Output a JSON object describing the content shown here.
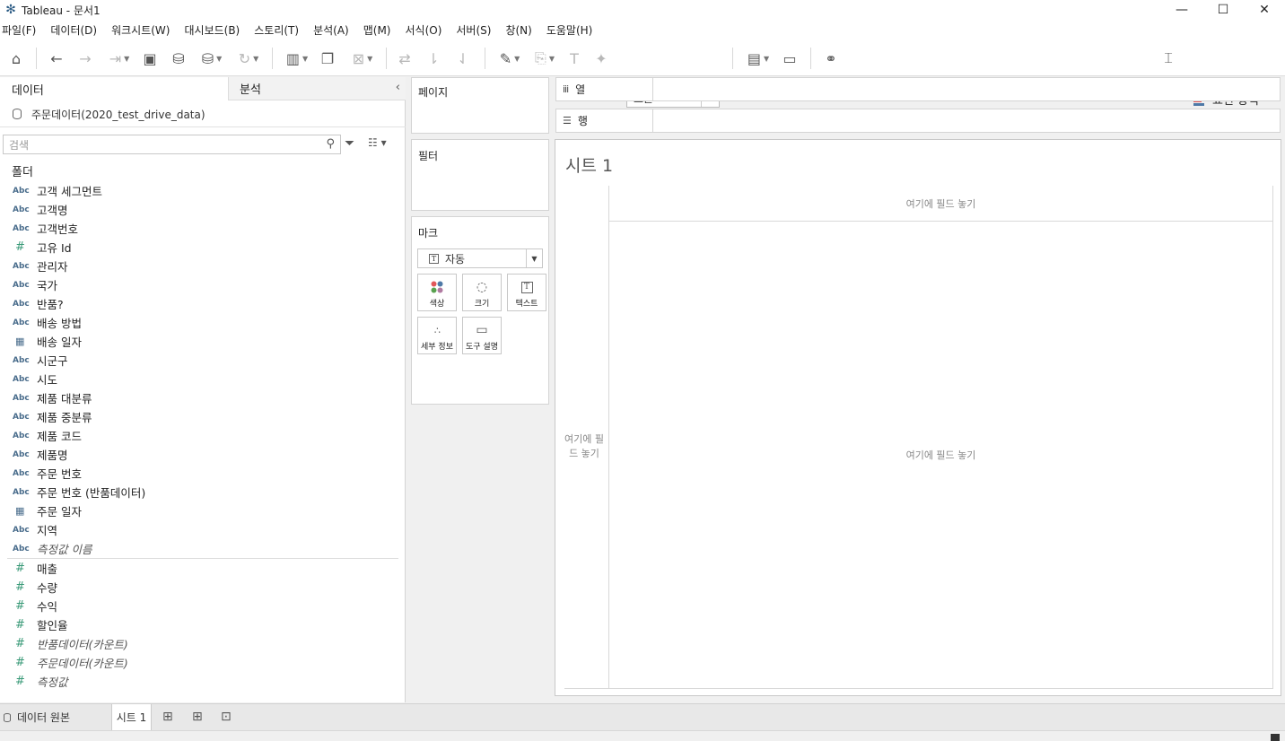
{
  "window": {
    "title": "Tableau - 문서1"
  },
  "menu": [
    "파일(F)",
    "데이터(D)",
    "워크시트(W)",
    "대시보드(B)",
    "스토리(T)",
    "분석(A)",
    "맵(M)",
    "서식(O)",
    "서버(S)",
    "창(N)",
    "도움말(H)"
  ],
  "toolbar": {
    "fit_value": "표준",
    "show_me_label": "표현 방식"
  },
  "data_pane": {
    "tab_data": "데이터",
    "tab_analysis": "분석",
    "datasource": "주문데이터(2020_test_drive_data)",
    "search_placeholder": "검색",
    "folder_label": "폴더",
    "type_abc": "Abc",
    "type_num": "#",
    "dimensions": [
      {
        "type": "abc",
        "name": "고객 세그먼트"
      },
      {
        "type": "abc",
        "name": "고객명"
      },
      {
        "type": "abc",
        "name": "고객번호"
      },
      {
        "type": "num",
        "name": "고유 Id"
      },
      {
        "type": "abc",
        "name": "관리자"
      },
      {
        "type": "abc",
        "name": "국가"
      },
      {
        "type": "abc",
        "name": "반품?"
      },
      {
        "type": "abc",
        "name": "배송 방법"
      },
      {
        "type": "date",
        "name": "배송 일자"
      },
      {
        "type": "abc",
        "name": "시군구"
      },
      {
        "type": "abc",
        "name": "시도"
      },
      {
        "type": "abc",
        "name": "제품 대분류"
      },
      {
        "type": "abc",
        "name": "제품 중분류"
      },
      {
        "type": "abc",
        "name": "제품 코드"
      },
      {
        "type": "abc",
        "name": "제품명"
      },
      {
        "type": "abc",
        "name": "주문 번호"
      },
      {
        "type": "abc",
        "name": "주문 번호 (반품데이터)"
      },
      {
        "type": "date",
        "name": "주문 일자"
      },
      {
        "type": "abc",
        "name": "지역"
      },
      {
        "type": "abc",
        "name": "측정값 이름",
        "italic": true
      }
    ],
    "measures": [
      {
        "type": "num",
        "name": "매출"
      },
      {
        "type": "num",
        "name": "수량"
      },
      {
        "type": "num",
        "name": "수익"
      },
      {
        "type": "num",
        "name": "할인율"
      },
      {
        "type": "num",
        "name": "반품데이터(카운트)",
        "italic": true
      },
      {
        "type": "num",
        "name": "주문데이터(카운트)",
        "italic": true
      },
      {
        "type": "num",
        "name": "측정값",
        "italic": true
      }
    ]
  },
  "cards": {
    "pages": "페이지",
    "filters": "필터",
    "marks": "마크",
    "mark_type": "자동",
    "mark_buttons": [
      "색상",
      "크기",
      "텍스트",
      "세부 정보",
      "도구 설명"
    ]
  },
  "shelves": {
    "columns": "열",
    "rows": "행"
  },
  "sheet": {
    "title": "시트 1",
    "drop_top": "여기에 필드 놓기",
    "drop_left": "여기에 필드 놓기",
    "drop_center": "여기에 필드 놓기"
  },
  "bottom": {
    "datasource_tab": "데이터 원본",
    "sheet_tab": "시트 1"
  },
  "colors": {
    "abc": "#4a6d8c",
    "measure": "#3a9a78",
    "showme_bars": [
      "#e15759",
      "#4e79a7",
      "#4e79a7",
      "#4e79a7"
    ]
  }
}
